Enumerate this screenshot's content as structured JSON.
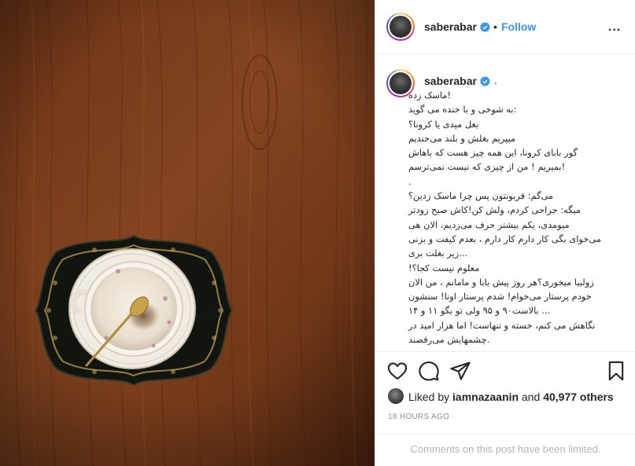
{
  "post": {
    "username": "saberabar",
    "follow_separator": "•",
    "follow_label": "Follow",
    "more_label": "...",
    "caption_username": "saberabar",
    "caption_prefix": ".",
    "caption_lines": [
      "!ماسک زده",
      ":به شوخی و با خنده می گوید",
      "بغل میدی یا کرونا؟",
      "میپریم بغلش و بلند می‌خندیم",
      "گور بابای کرونا، این همه چیز هست که باهاش",
      "!بمیریم ! من از چیزی که نیست نمی‌ترسم",
      ".",
      "می‌گم: قربونتون پس چرا ماسک زدین؟",
      "میگه: جراحی کردم، ولش کن!کاش صبح زودتر",
      "میومدی، یکم بیشتر حرف می‌زدیم، الان هی",
      "می‌خوای بگی کار دارم کار دارم ، بعدم کیفت و بزنی",
      "...زیر بغلت بری",
      "معلوم نیست کجا؟!",
      "زولبیا میخوری؟هر روز پیش بابا و مامانم ، من الان",
      "خودم پرستار می‌خوام! شدم پرستار اونا! سنشون",
      "... بالاست۹۰ و ۹۵ ولی تو بگو ۱۱ و ۱۴",
      "نگاهش می کنم، خسته و تنهاست! اما هزار امید در",
      ".چشمهایش می‌رقصند"
    ],
    "likes": {
      "prefix": "Liked by",
      "user": "iamnazaanin",
      "and": "and",
      "count": "40,977 others"
    },
    "timestamp": "18 HOURS AGO",
    "comments_limited": "Comments on this post have been limited."
  },
  "colors": {
    "accent": "#3897f0",
    "text": "#262626",
    "muted": "#8e8e8e",
    "wood": "#7a3d1f"
  },
  "icons": [
    "verified-badge-icon",
    "heart-icon",
    "comment-icon",
    "share-icon",
    "bookmark-icon",
    "more-options-icon"
  ]
}
